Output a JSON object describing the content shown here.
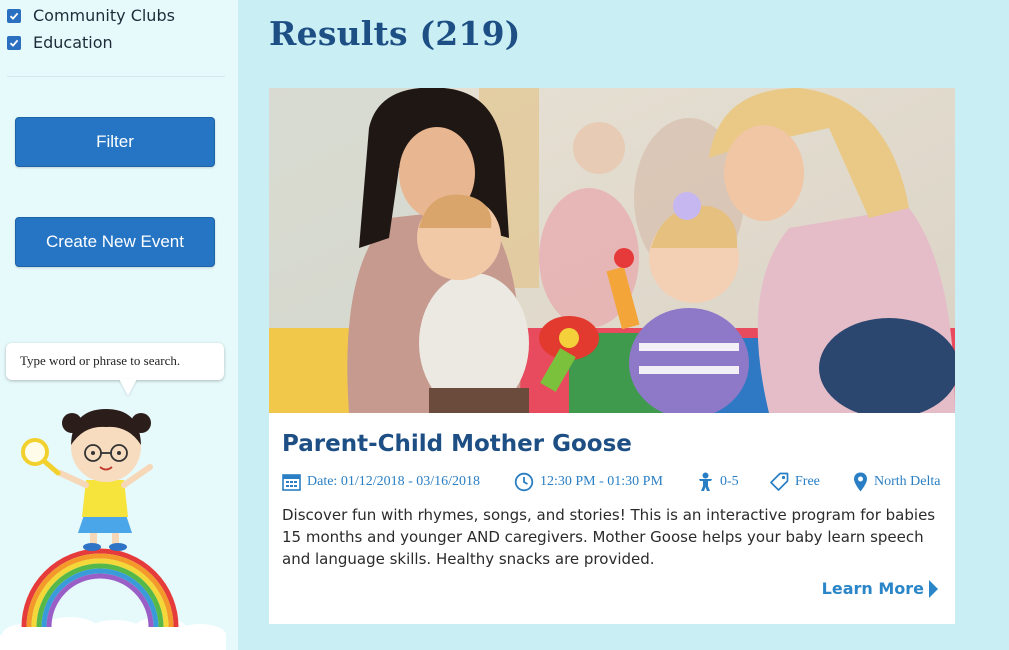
{
  "sidebar": {
    "categories": [
      {
        "label": "Community Clubs",
        "checked": true
      },
      {
        "label": "Education",
        "checked": true
      }
    ],
    "filter_label": "Filter",
    "create_label": "Create New Event",
    "search_hint": "Type word or phrase to search."
  },
  "main": {
    "results_title": "Results (219)",
    "event": {
      "title": "Parent-Child Mother Goose",
      "date": "Date: 01/12/2018 - 03/16/2018",
      "time": "12:30 PM - 01:30 PM",
      "age": "0-5",
      "price": "Free",
      "location": "North Delta",
      "description": "Discover fun with rhymes, songs, and stories! This is an interactive program for babies 15 months and younger AND caregivers. Mother Goose helps your baby learn speech and language skills. Healthy snacks are provided.",
      "learn_more": "Learn More"
    }
  },
  "colors": {
    "accent": "#2575c4",
    "title": "#1d4f85",
    "link": "#2a86c8",
    "page_bg": "#c9eef3",
    "sidebar_bg": "#e6f9fb"
  },
  "icons": [
    "checkbox-icon",
    "calendar-icon",
    "clock-icon",
    "child-icon",
    "tag-icon",
    "location-pin-icon",
    "play-arrow-icon",
    "magnifier-icon"
  ]
}
